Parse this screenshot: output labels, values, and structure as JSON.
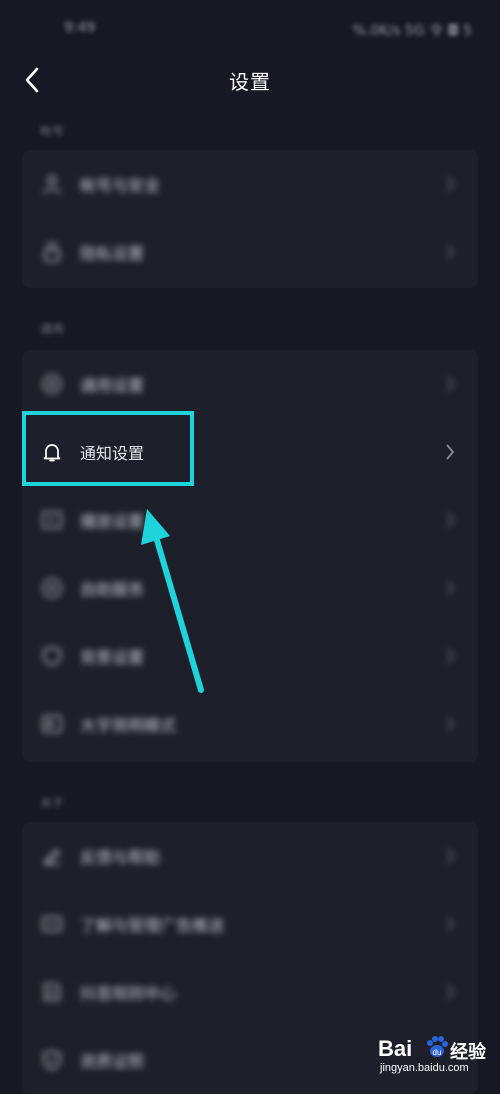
{
  "status_bar": {
    "time": "9:49",
    "indicators": "%.0K/s 5G 令 ◘ 5"
  },
  "header": {
    "title": "设置",
    "back_icon": "chevron-left-icon"
  },
  "sections": [
    {
      "label": "帐号",
      "items": [
        {
          "label": "帐号与安全",
          "icon": "person-icon"
        },
        {
          "label": "隐私设置",
          "icon": "lock-icon"
        }
      ]
    },
    {
      "label": "通用",
      "items": [
        {
          "label": "通用设置",
          "icon": "gear-icon"
        },
        {
          "label": "通知设置",
          "icon": "bell-icon"
        },
        {
          "label": "播放设置",
          "icon": "play-icon"
        },
        {
          "label": "自助服务",
          "icon": "service-icon"
        },
        {
          "label": "背景设置",
          "icon": "shield-icon"
        },
        {
          "label": "大字简明模式",
          "icon": "font-size-icon"
        }
      ]
    },
    {
      "label": "关于",
      "items": [
        {
          "label": "反馈与帮助",
          "icon": "edit-icon"
        },
        {
          "label": "了解与管理广告推送",
          "icon": "ad-icon"
        },
        {
          "label": "抖音规则中心",
          "icon": "book-icon"
        },
        {
          "label": "资质证照",
          "icon": "badge-icon"
        }
      ]
    }
  ],
  "annotation": {
    "highlight_color": "#1fd3da",
    "highlighted_item": "通知设置"
  },
  "watermark": {
    "logo_text": "Bai",
    "logo_text_2": "经验",
    "url": "jingyan.baidu.com"
  }
}
